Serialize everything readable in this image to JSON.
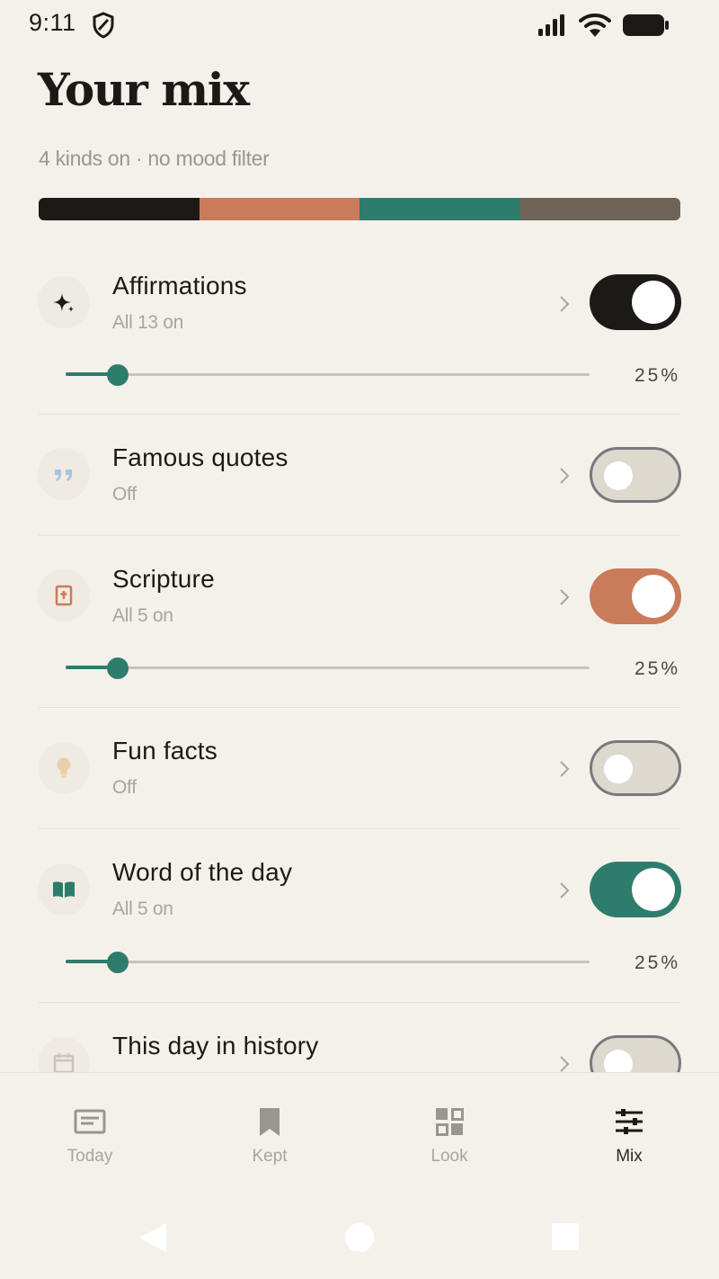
{
  "status": {
    "time": "9:11"
  },
  "header": {
    "title": "Your mix",
    "subtitle": "4 kinds on · no mood filter"
  },
  "mix_bar": {
    "segments": [
      "#1c1a17",
      "#c97b5a",
      "#2e7c6b",
      "#6f6457"
    ]
  },
  "items": [
    {
      "title": "Affirmations",
      "subtitle": "All 13 on",
      "on": true,
      "color": "#1c1a17",
      "icon": "sparkle-icon",
      "slider_percent": "25%",
      "slider_fraction": 0.1
    },
    {
      "title": "Famous quotes",
      "subtitle": "Off",
      "on": false,
      "icon": "quote-icon"
    },
    {
      "title": "Scripture",
      "subtitle": "All 5 on",
      "on": true,
      "color": "#c97b5a",
      "icon": "bible-icon",
      "slider_percent": "25%",
      "slider_fraction": 0.1
    },
    {
      "title": "Fun facts",
      "subtitle": "Off",
      "on": false,
      "icon": "lightbulb-icon"
    },
    {
      "title": "Word of the day",
      "subtitle": "All 5 on",
      "on": true,
      "color": "#2e7c6b",
      "icon": "open-book-icon",
      "slider_percent": "25%",
      "slider_fraction": 0.1
    },
    {
      "title": "This day in history",
      "subtitle": "",
      "on": false,
      "icon": "calendar-icon"
    }
  ],
  "nav": [
    {
      "label": "Today",
      "icon": "newspaper-icon",
      "active": false
    },
    {
      "label": "Kept",
      "icon": "bookmark-icon",
      "active": false
    },
    {
      "label": "Look",
      "icon": "grid-icon",
      "active": false
    },
    {
      "label": "Mix",
      "icon": "sliders-icon",
      "active": true
    }
  ]
}
